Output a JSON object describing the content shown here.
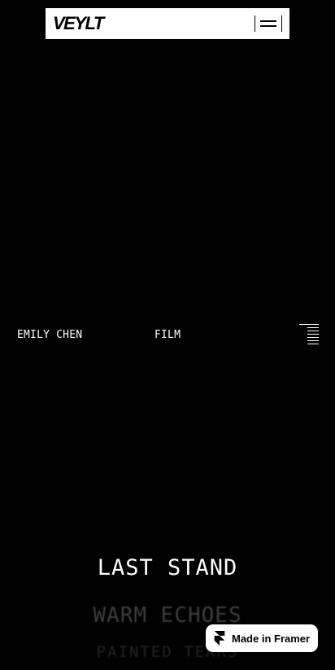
{
  "header": {
    "logo": "VEYLT",
    "menu_button": "menu-icon"
  },
  "meta": {
    "author": "EMILY CHEN",
    "category": "FILM",
    "scale_icon": "ruler-lines-icon"
  },
  "titles": [
    "LAST STAND",
    "WARM ECHOES",
    "PAINTED TEARS"
  ],
  "badge": {
    "label": "Made in Framer",
    "icon": "framer-icon"
  },
  "colors": {
    "background": "#000000",
    "topbar": "#ffffff",
    "text_primary": "#ffffff",
    "text_faded": "#3d3d3d"
  }
}
